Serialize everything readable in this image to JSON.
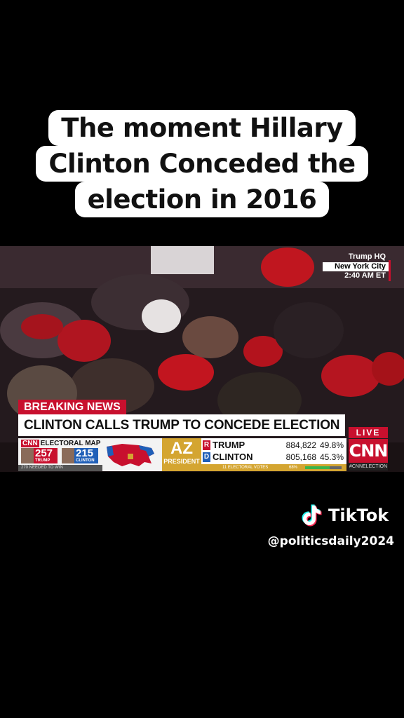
{
  "caption": {
    "lines": [
      "The moment Hillary",
      "Clinton Conceded the",
      "election in 2016"
    ]
  },
  "broadcast": {
    "location": {
      "line1": "Trump HQ",
      "line2": "New York City",
      "line3": "2:40 AM ET"
    },
    "breaking_label": "BREAKING NEWS",
    "headline": "CLINTON CALLS TRUMP TO CONCEDE ELECTION",
    "live_label": "LIVE",
    "network": "CNN",
    "hashtag": "#CNNELECTION",
    "electoral_map": {
      "title_brand": "CNN",
      "title": "ELECTORAL MAP",
      "republican": {
        "votes": "257",
        "name": "TRUMP"
      },
      "democrat": {
        "votes": "215",
        "name": "CLINTON"
      },
      "needed": "270 NEEDED TO WIN"
    },
    "state": {
      "code": "AZ",
      "race": "PRESIDENT",
      "electoral_votes": "11 ELECTORAL VOTES",
      "reporting": "68%",
      "reporting_fraction": 0.68,
      "results": [
        {
          "party": "R",
          "name": "TRUMP",
          "votes": "884,822",
          "pct": "49.8%"
        },
        {
          "party": "D",
          "name": "CLINTON",
          "votes": "805,168",
          "pct": "45.3%"
        }
      ]
    },
    "colors": {
      "republican": "#c8102e",
      "democrat": "#1f5fb8",
      "state_panel": "#d4a531"
    }
  },
  "tiktok": {
    "brand": "TikTok",
    "icon": "tiktok-note-icon",
    "handle": "@politicsdaily2024"
  }
}
